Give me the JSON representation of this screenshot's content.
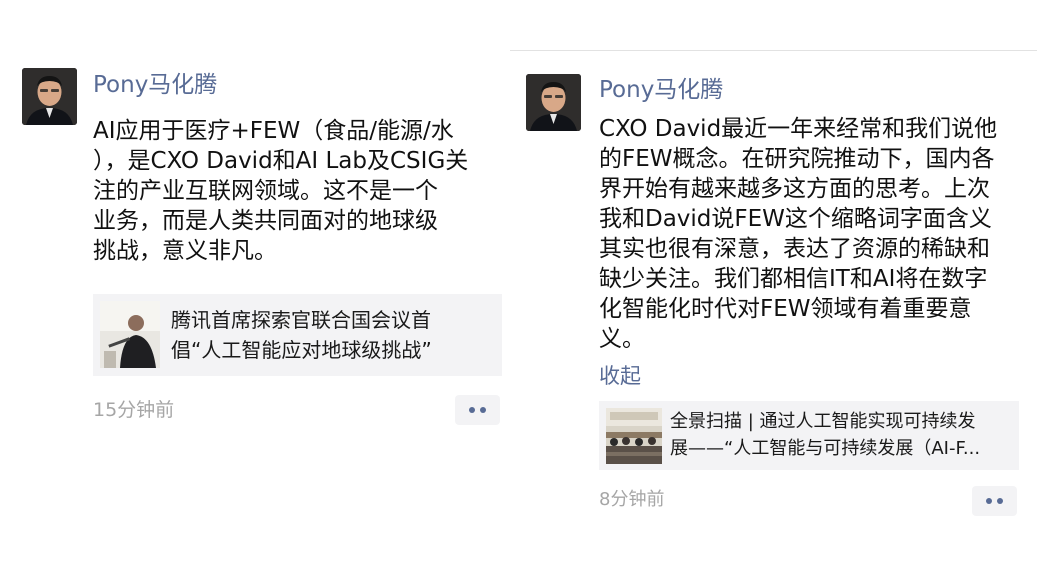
{
  "posts": [
    {
      "author": "Pony马化腾",
      "content_lines": [
        "AI应用于医疗+FEW（食品/能源/水",
        "），是CXO David和AI Lab及CSIG关",
        "注的产业互联网领域。这不是一个",
        "业务，而是人类共同面对的地球级",
        "挑战，意义非凡。"
      ],
      "link_card": {
        "title_lines": [
          "腾讯首席探索官联合国会议首",
          "倡“人工智能应对地球级挑战”"
        ]
      },
      "timestamp": "15分钟前"
    },
    {
      "author": "Pony马化腾",
      "content_lines": [
        "CXO David最近一年来经常和我们说他",
        "的FEW概念。在研究院推动下，国内各",
        "界开始有越来越多这方面的思考。上次",
        "我和David说FEW这个缩略词字面含义",
        "其实也很有深意，表达了资源的稀缺和",
        "缺少关注。我们都相信IT和AI将在数字",
        "化智能化时代对FEW领域有着重要意",
        "义。"
      ],
      "collapse_label": "收起",
      "link_card": {
        "title_lines": [
          "全景扫描 | 通过人工智能实现可持续发",
          "展——“人工智能与可持续发展（AI-F..."
        ]
      },
      "timestamp": "8分钟前"
    }
  ],
  "colors": {
    "nickname": "#586b95",
    "body_text": "#111111",
    "timestamp": "#a6a6a6",
    "card_background": "#f3f3f5"
  },
  "icons": {
    "more": "two-dots-icon"
  }
}
